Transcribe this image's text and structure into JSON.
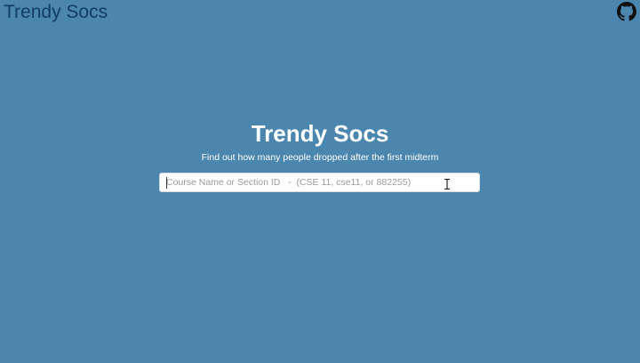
{
  "header": {
    "brand": "Trendy Socs",
    "github_icon": "github-icon"
  },
  "hero": {
    "title": "Trendy Socs",
    "subtitle": "Find out how many people dropped after the first midterm"
  },
  "search": {
    "placeholder": "Course Name or Section ID   -  (CSE 11, cse11, or 882255)",
    "value": ""
  },
  "colors": {
    "background": "#4a86ae",
    "brand_text": "#123c64",
    "hero_text": "#ffffff"
  }
}
